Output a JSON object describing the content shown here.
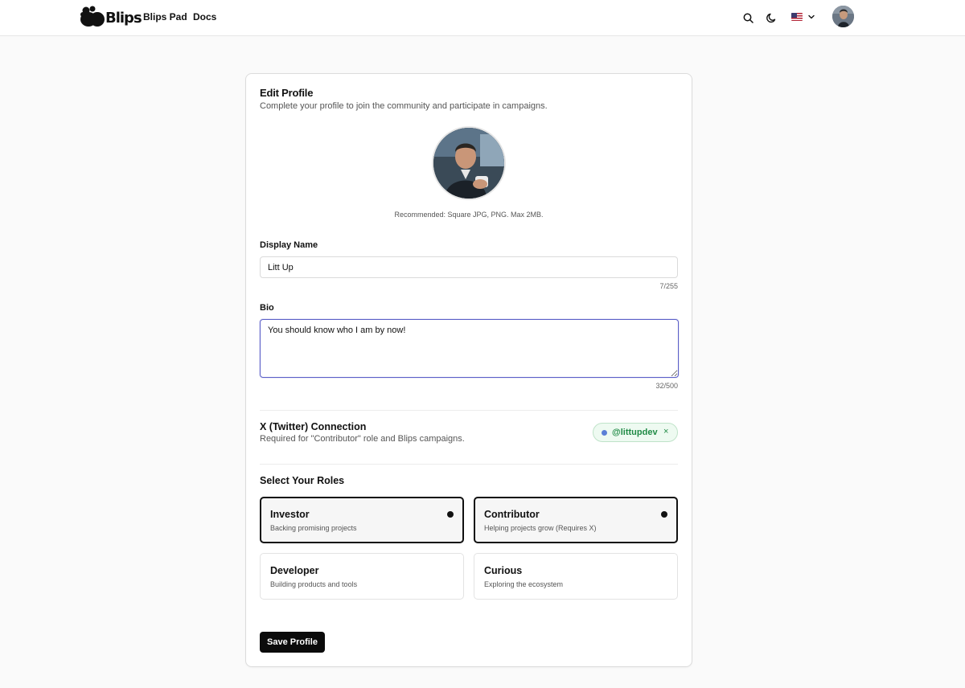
{
  "header": {
    "brand": "Blips",
    "nav": [
      {
        "label": "Blips Pad"
      },
      {
        "label": "Docs"
      }
    ],
    "icons": [
      "search-icon",
      "moon-icon",
      "us-flag-icon",
      "chevron-down-icon"
    ]
  },
  "profile": {
    "title": "Edit Profile",
    "subtitle": "Complete your profile to join the community and participate in campaigns.",
    "avatar_hint": "Recommended: Square JPG, PNG. Max 2MB.",
    "display_name": {
      "label": "Display Name",
      "value": "Litt Up",
      "counter": "7/255"
    },
    "bio": {
      "label": "Bio",
      "value": "You should know who I am by now!",
      "counter": "32/500"
    },
    "twitter": {
      "title": "X (Twitter) Connection",
      "subtitle": "Required for \"Contributor\" role and Blips campaigns.",
      "handle": "@littupdev",
      "remove_glyph": "×",
      "status_color": "#1f8a45"
    },
    "roles": {
      "title": "Select Your Roles",
      "items": [
        {
          "name": "Investor",
          "desc": "Backing promising projects",
          "selected": true
        },
        {
          "name": "Contributor",
          "desc": "Helping projects grow (Requires X)",
          "selected": true
        },
        {
          "name": "Developer",
          "desc": "Building products and tools",
          "selected": false
        },
        {
          "name": "Curious",
          "desc": "Exploring the ecosystem",
          "selected": false
        }
      ]
    },
    "save_label": "Save Profile"
  },
  "colors": {
    "accent": "#5b5fc7",
    "button": "#0b0b0b",
    "success": "#1f8a45"
  }
}
